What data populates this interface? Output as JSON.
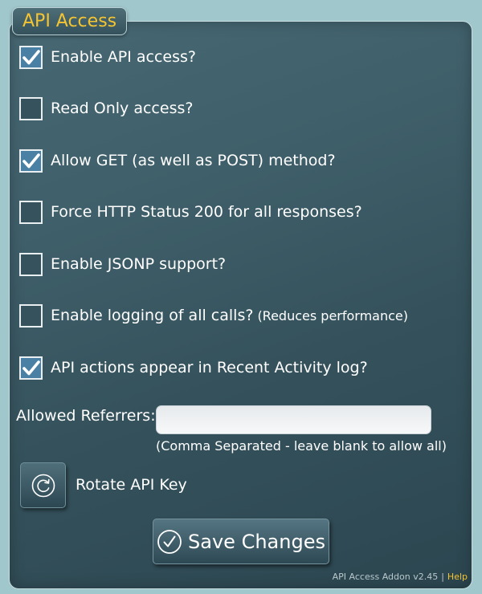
{
  "panel": {
    "title": "API Access"
  },
  "options": [
    {
      "label": "Enable API access?",
      "note": "",
      "checked": true
    },
    {
      "label": "Read Only access?",
      "note": "",
      "checked": false
    },
    {
      "label": "Allow GET (as well as POST) method?",
      "note": "",
      "checked": true
    },
    {
      "label": "Force HTTP Status 200 for all responses?",
      "note": "",
      "checked": false
    },
    {
      "label": "Enable JSONP support?",
      "note": "",
      "checked": false
    },
    {
      "label": "Enable logging of all calls?",
      "note": "(Reduces performance)",
      "checked": false
    },
    {
      "label": "API actions appear in Recent Activity log?",
      "note": "",
      "checked": true
    }
  ],
  "referrers": {
    "label": "Allowed Referrers:",
    "value": "",
    "hint": "(Comma Separated - leave blank to allow all)"
  },
  "rotate": {
    "label": "Rotate API Key",
    "icon": "rotate-icon"
  },
  "save": {
    "label": "Save Changes",
    "icon": "check-circle-icon"
  },
  "footer": {
    "version": "API Access Addon v2.45",
    "separator": "|",
    "help": "Help"
  },
  "colors": {
    "accent": "#f4c431",
    "panel": "#3f5f6a",
    "checked": "#4a80a4"
  }
}
